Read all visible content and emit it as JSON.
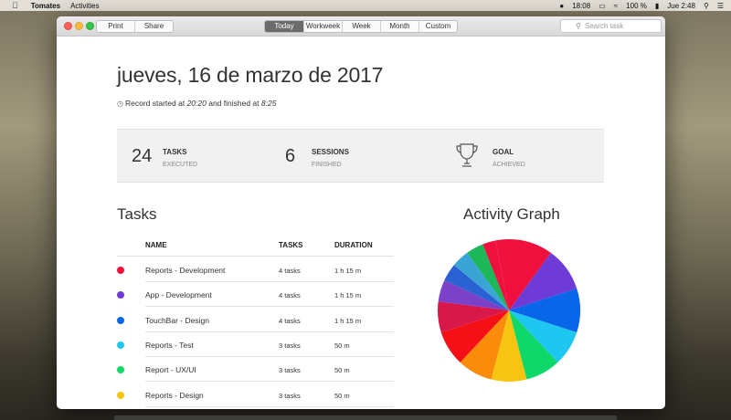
{
  "menubar": {
    "app_name": "Tomates",
    "menus": [
      "Activities"
    ],
    "time_small": "18:08",
    "battery": "100 %",
    "clock": "Jue 2:48"
  },
  "toolbar": {
    "print_label": "Print",
    "share_label": "Share",
    "tabs": [
      {
        "label": "Today",
        "active": true
      },
      {
        "label": "Workweek",
        "active": false
      },
      {
        "label": "Week",
        "active": false
      },
      {
        "label": "Month",
        "active": false
      },
      {
        "label": "Custom",
        "active": false
      }
    ],
    "search_placeholder": "Search task"
  },
  "header": {
    "date": "jueves, 16 de marzo de 2017",
    "record_prefix": "Record started at",
    "start_time": "20:20",
    "record_middle": "and finished at",
    "end_time": "8:25"
  },
  "stats": {
    "tasks": {
      "number": "24",
      "title": "TASKS",
      "sub": "EXECUTED"
    },
    "sessions": {
      "number": "6",
      "title": "SESSIONS",
      "sub": "FINISHED"
    },
    "goal": {
      "title": "GOAL",
      "sub": "ACHIEVED",
      "icon": "trophy-icon"
    }
  },
  "tasks_section": {
    "title": "Tasks",
    "columns": {
      "name": "NAME",
      "tasks": "TASKS",
      "duration": "DURATION"
    },
    "rows": [
      {
        "name": "Reports - Development",
        "tasks": "4 tasks",
        "duration": "1 h 15 m",
        "color": "#f0103e"
      },
      {
        "name": "App - Development",
        "tasks": "4 tasks",
        "duration": "1 h 15 m",
        "color": "#6f3bd6"
      },
      {
        "name": "TouchBar - Design",
        "tasks": "4 tasks",
        "duration": "1 h 15 m",
        "color": "#0a66e8"
      },
      {
        "name": "Reports - Test",
        "tasks": "3 tasks",
        "duration": "50 m",
        "color": "#1ec7ef"
      },
      {
        "name": "Report - UX/UI",
        "tasks": "3 tasks",
        "duration": "50 m",
        "color": "#0fd86a"
      },
      {
        "name": "Reports - Design",
        "tasks": "3 tasks",
        "duration": "50 m",
        "color": "#f6c511"
      }
    ]
  },
  "activity_graph": {
    "title": "Activity Graph"
  },
  "chart_data": {
    "type": "pie",
    "values": [
      10,
      10,
      10,
      8,
      8,
      8,
      8,
      8,
      7,
      5,
      4,
      4,
      4,
      3,
      3
    ],
    "colors": [
      "#f0103e",
      "#6f3bd6",
      "#0a66e8",
      "#1ec7ef",
      "#0fd86a",
      "#f6c511",
      "#fb8b0a",
      "#f50f17",
      "#d9184a",
      "#7b42c9",
      "#2a62d4",
      "#3aa5d5",
      "#1db75a",
      "#f0103e",
      "#f0103e"
    ]
  }
}
